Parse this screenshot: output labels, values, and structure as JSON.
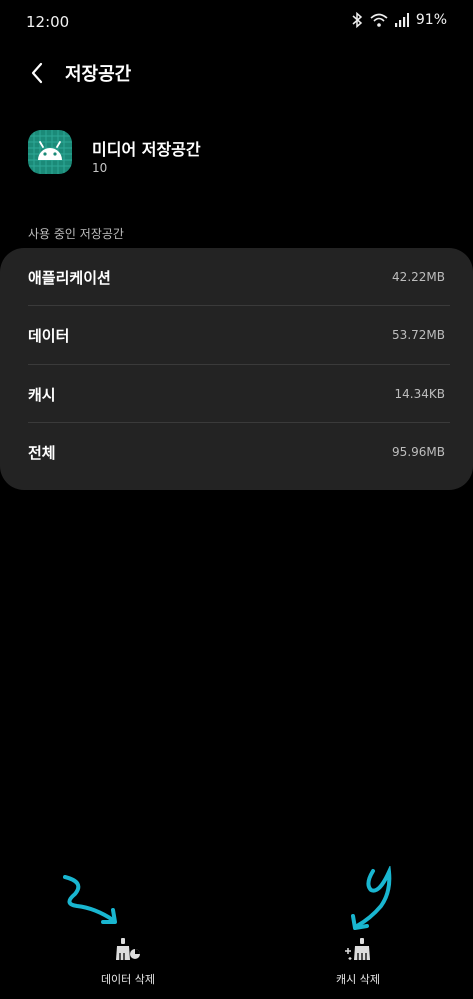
{
  "status_bar": {
    "time": "12:00",
    "battery": "91%",
    "icons": [
      "bluetooth-icon",
      "wifi-icon",
      "signal-icon"
    ]
  },
  "header": {
    "back_icon": "back-arrow-icon",
    "title": "저장공간"
  },
  "app": {
    "icon": "android-icon",
    "icon_color": "#1b8a78",
    "name": "미디어 저장공간",
    "version": "10"
  },
  "storage": {
    "section_label": "사용 중인 저장공간",
    "rows": [
      {
        "label": "애플리케이션",
        "value": "42.22MB"
      },
      {
        "label": "데이터",
        "value": "53.72MB"
      },
      {
        "label": "캐시",
        "value": "14.34KB"
      },
      {
        "label": "전체",
        "value": "95.96MB"
      }
    ]
  },
  "actions": {
    "clear_data": {
      "label": "데이터 삭제",
      "icon": "clear-data-icon"
    },
    "clear_cache": {
      "label": "캐시 삭제",
      "icon": "clear-cache-icon"
    }
  },
  "annotation_color": "#19b6d0"
}
